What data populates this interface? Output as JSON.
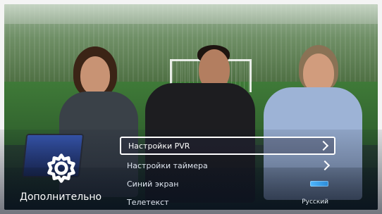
{
  "panel": {
    "title": "Дополнительно",
    "icon": "gear-icon"
  },
  "menu": {
    "items": [
      {
        "label": "Настройки PVR",
        "control": "chevron",
        "focused": true
      },
      {
        "label": "Настройки таймера",
        "control": "chevron",
        "focused": false
      },
      {
        "label": "Синий экран",
        "control": "toggle",
        "focused": false
      },
      {
        "label": "Телетекст",
        "control": "value",
        "value": "Русский",
        "focused": false
      }
    ]
  },
  "colors": {
    "accent": "#2c8bd6",
    "text": "#ffffff"
  }
}
